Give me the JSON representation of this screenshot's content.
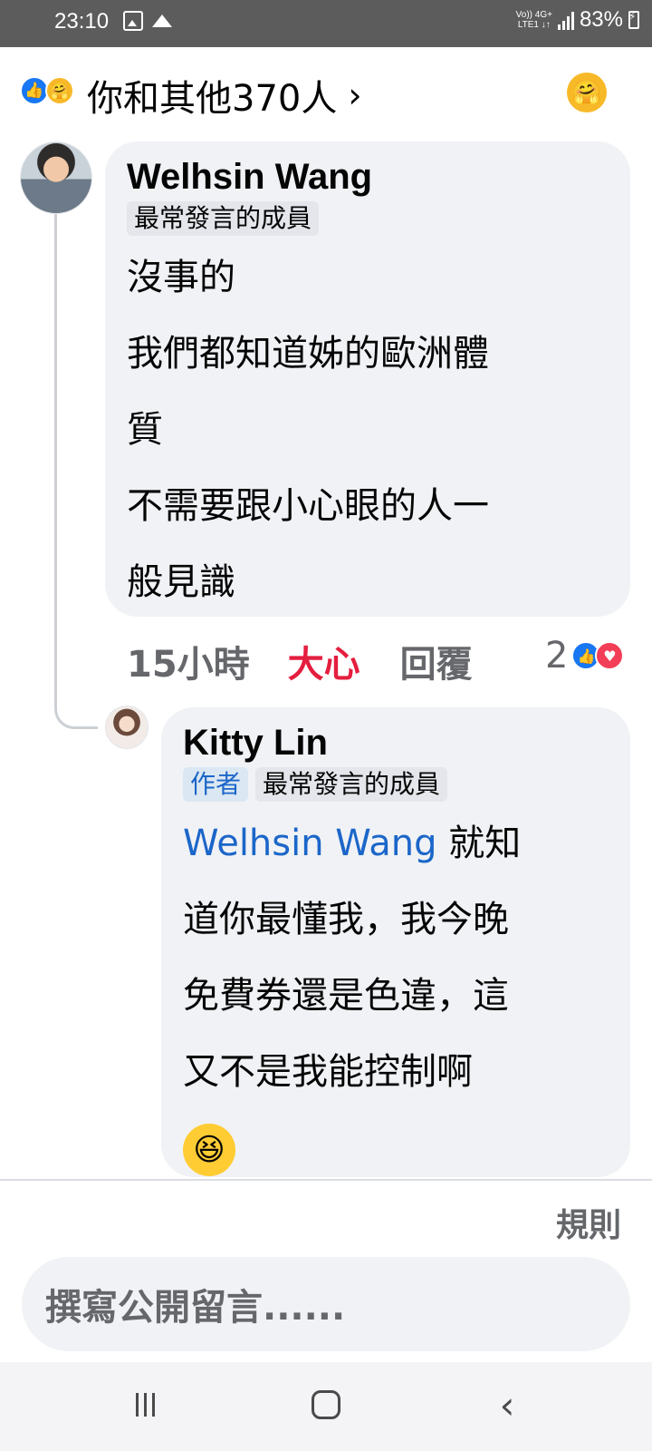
{
  "status_bar": {
    "time": "23:10",
    "network_top": "Vo))  4G+",
    "network_bottom": "LTE1  ↓↑",
    "battery": "83%"
  },
  "reactions_header": {
    "summary": "你和其他370人",
    "icons": [
      "like-icon",
      "care-icon",
      "chevron-right-icon",
      "care-icon"
    ]
  },
  "comments": [
    {
      "author": "Welhsin Wang",
      "badges": [
        "最常發言的成員"
      ],
      "lines": [
        "沒事的",
        "我們都知道姊的歐洲體",
        "質",
        "不需要跟小心眼的人一",
        "般見識"
      ],
      "actions": {
        "time": "15小時",
        "reaction": "大心",
        "reply": "回覆",
        "count": "2"
      }
    },
    {
      "author": "Kitty Lin",
      "badges": [
        "作者",
        "最常發言的成員"
      ],
      "mention": "Welhsin Wang",
      "lines": [
        " 就知",
        "道你最懂我，我今晚",
        "免費券還是色違，這",
        "又不是我能控制啊"
      ],
      "emoji": "😆"
    }
  ],
  "footer": {
    "rules": "規則",
    "input_placeholder": "撰寫公開留言......"
  },
  "colors": {
    "link_blue": "#1b66c9",
    "love_red": "#e41e3f",
    "bubble_bg": "#f0f2f5",
    "secondary_text": "#65676b"
  }
}
